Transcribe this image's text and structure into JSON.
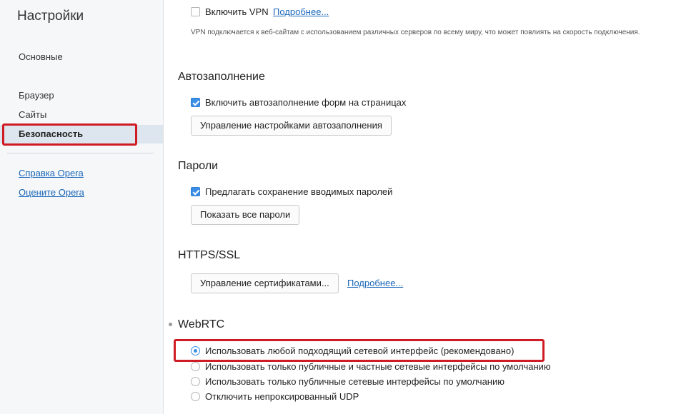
{
  "sidebar": {
    "title": "Настройки",
    "items": [
      {
        "label": "Основные"
      },
      {
        "label": "Браузер"
      },
      {
        "label": "Сайты"
      },
      {
        "label": "Безопасность",
        "active": true
      }
    ],
    "links": [
      {
        "label": "Справка Opera"
      },
      {
        "label": "Оцените Opera"
      }
    ]
  },
  "vpn": {
    "checkbox_label": "Включить VPN",
    "checked": false,
    "more_link": "Подробнее...",
    "description": "VPN подключается к веб-сайтам с использованием различных серверов по всему миру, что может повлиять на скорость подключения."
  },
  "autofill": {
    "title": "Автозаполнение",
    "checkbox_label": "Включить автозаполнение форм на страницах",
    "checked": true,
    "button": "Управление настройками автозаполнения"
  },
  "passwords": {
    "title": "Пароли",
    "checkbox_label": "Предлагать сохранение вводимых паролей",
    "checked": true,
    "button": "Показать все пароли"
  },
  "https": {
    "title": "HTTPS/SSL",
    "button": "Управление сертификатами...",
    "more_link": "Подробнее..."
  },
  "webrtc": {
    "title": "WebRTC",
    "options": [
      {
        "label": "Использовать любой подходящий сетевой интерфейс (рекомендовано)",
        "selected": true
      },
      {
        "label": "Использовать только публичные и частные сетевые интерфейсы по умолчанию",
        "selected": false
      },
      {
        "label": "Использовать только публичные сетевые интерфейсы по умолчанию",
        "selected": false
      },
      {
        "label": "Отключить непроксированный UDP",
        "selected": false
      }
    ]
  },
  "colors": {
    "accent": "#3b8ee5",
    "link": "#1a67b8",
    "highlight_box": "#cf1b23",
    "sidebar_bg": "#f6f7f9",
    "active_item_bg": "#dde6ee"
  }
}
